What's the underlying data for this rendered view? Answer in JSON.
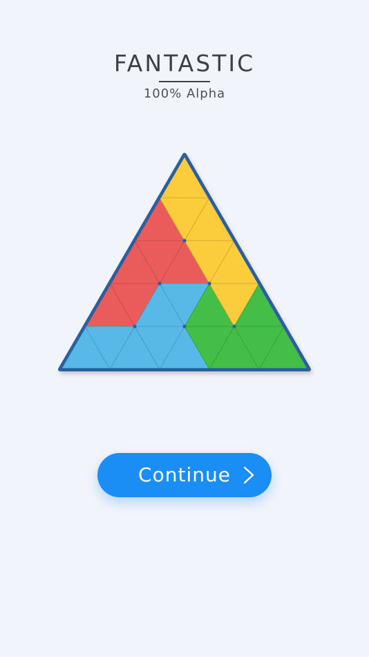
{
  "header": {
    "title": "FANTASTIC",
    "subtitle": "100% Alpha"
  },
  "colors": {
    "background": "#f1f4fa",
    "border": "#2c5f9e",
    "button": "#1b8ef5",
    "pieces": {
      "yellow": "#fbcc3b",
      "red": "#ea5c5b",
      "blue": "#58b8e8",
      "green": "#45be48"
    }
  },
  "board": {
    "rows": 5,
    "shape": "triangle",
    "cells": [
      [
        "yellow"
      ],
      [
        "red",
        "yellow",
        "yellow"
      ],
      [
        "red",
        "red",
        "red",
        "yellow",
        "yellow"
      ],
      [
        "red",
        "red",
        "blue",
        "blue",
        "green",
        "yellow",
        "green"
      ],
      [
        "blue",
        "blue",
        "blue",
        "blue",
        "blue",
        "green",
        "green",
        "green",
        "green"
      ]
    ],
    "completion_percent": 100
  },
  "continue_button": {
    "label": "Continue",
    "icon": "chevron-right-icon"
  }
}
